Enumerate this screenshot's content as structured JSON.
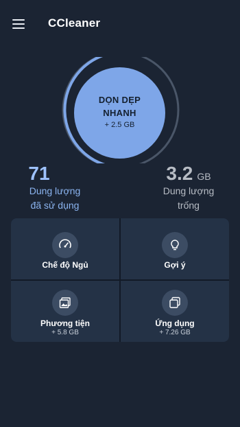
{
  "header": {
    "title": "CCleaner",
    "menu_icon": "menu-icon"
  },
  "quick_clean": {
    "label_line1": "DỌN DẸP",
    "label_line2": "NHANH",
    "size": "+ 2.5 GB",
    "ring_progress": 0.75
  },
  "storage": {
    "used": {
      "value": "71",
      "label_line1": "Dung lượng",
      "label_line2": "đã sử dụng"
    },
    "free": {
      "value": "3.2",
      "unit": "GB",
      "label_line1": "Dung lượng",
      "label_line2": "trống"
    }
  },
  "tiles": [
    {
      "label": "Chế độ Ngủ",
      "sub": "",
      "icon": "speedometer-icon"
    },
    {
      "label": "Gợi ý",
      "sub": "",
      "icon": "lightbulb-icon"
    },
    {
      "label": "Phương tiện",
      "sub": "+ 5.8 GB",
      "icon": "media-gallery-icon"
    },
    {
      "label": "Ứng dụng",
      "sub": "+ 7.26 GB",
      "icon": "apps-stack-icon"
    }
  ],
  "colors": {
    "background": "#1b2433",
    "accent": "#7ea6e8",
    "tile": "#243246"
  }
}
